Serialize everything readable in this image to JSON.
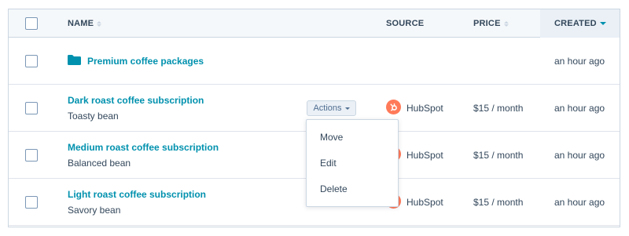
{
  "columns": {
    "name": "NAME",
    "source": "SOURCE",
    "price": "PRICE",
    "created": "CREATED"
  },
  "colors": {
    "link": "#0091ae",
    "hubspot": "#ff7a59",
    "border": "#cbd6e2",
    "header_bg": "#f5f8fa"
  },
  "rows": [
    {
      "name": "Premium coffee packages",
      "type": "folder",
      "icon": "folder-icon",
      "created": "an hour ago"
    },
    {
      "name": "Dark roast coffee subscription",
      "subtitle": "Toasty bean",
      "source": "HubSpot",
      "icon": "hubspot-sprocket-icon",
      "price": "$15 / month",
      "created": "an hour ago"
    },
    {
      "name": "Medium roast coffee subscription",
      "subtitle": "Balanced bean",
      "source": "HubSpot",
      "icon": "hubspot-sprocket-icon",
      "price": "$15 / month",
      "created": "an hour ago"
    },
    {
      "name": "Light roast coffee subscription",
      "subtitle": "Savory bean",
      "source": "HubSpot",
      "icon": "hubspot-sprocket-icon",
      "price": "$15 / month",
      "created": "an hour ago"
    }
  ],
  "actions": {
    "label": "Actions",
    "menu": [
      "Move",
      "Edit",
      "Delete"
    ]
  }
}
